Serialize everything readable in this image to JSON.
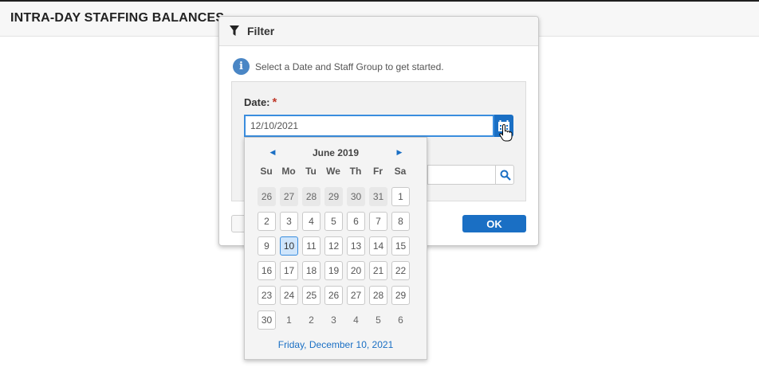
{
  "page": {
    "title": "INTRA-DAY STAFFING BALANCES"
  },
  "dialog": {
    "title": "Filter",
    "info_text": "Select a Date and Staff Group to get started.",
    "date_label": "Date:",
    "required_mark": "*",
    "date_value": "12/10/2021",
    "ok_label": "OK"
  },
  "calendar": {
    "month_title": "June 2019",
    "weekdays": [
      "Su",
      "Mo",
      "Tu",
      "We",
      "Th",
      "Fr",
      "Sa"
    ],
    "weeks": [
      [
        "26",
        "27",
        "28",
        "29",
        "30",
        "31",
        "1"
      ],
      [
        "2",
        "3",
        "4",
        "5",
        "6",
        "7",
        "8"
      ],
      [
        "9",
        "10",
        "11",
        "12",
        "13",
        "14",
        "15"
      ],
      [
        "16",
        "17",
        "18",
        "19",
        "20",
        "21",
        "22"
      ],
      [
        "23",
        "24",
        "25",
        "26",
        "27",
        "28",
        "29"
      ],
      [
        "30",
        "1",
        "2",
        "3",
        "4",
        "5",
        "6"
      ]
    ],
    "selected_day": "10",
    "footer_text": "Friday, December 10, 2021"
  },
  "colors": {
    "accent": "#1a6fc4",
    "selected_bg": "#cfe5fb",
    "required": "#c0392b"
  }
}
